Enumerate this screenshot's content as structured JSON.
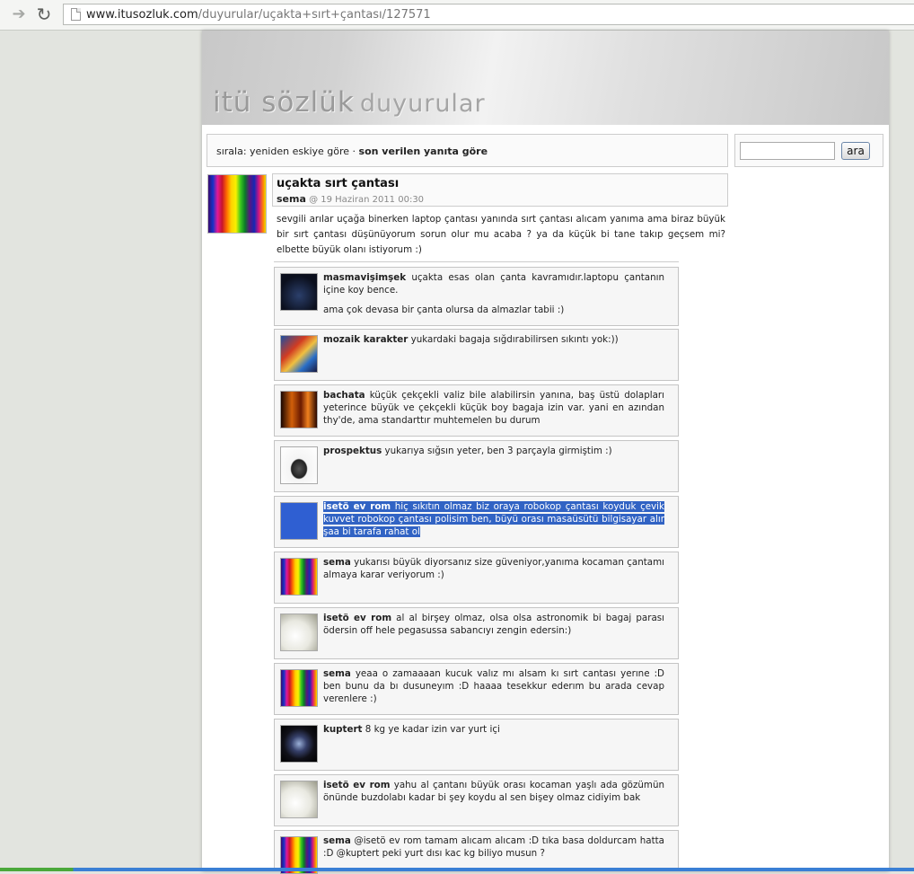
{
  "browser": {
    "back_icon": "arrow-right-icon",
    "reload_icon": "reload-icon",
    "url_domain": "www.itusozluk.com",
    "url_path": "/duyurular/uçakta+sırt+çantası/127571"
  },
  "site": {
    "logo_main": "itü sözlük",
    "logo_sub": "duyurular"
  },
  "sort": {
    "prefix": "sırala: yeniden eskiye göre · ",
    "active": "son verilen yanıta göre"
  },
  "search": {
    "value": "",
    "button_label": "ara"
  },
  "topic": {
    "title": "uçakta sırt çantası",
    "author": "sema",
    "date": " @ 19 Haziran 2011 00:30",
    "body": "sevgili arılar uçağa binerken laptop çantası yanında sırt çantası alıcam yanıma ama biraz büyük bir sırt çantası düşünüyorum sorun olur mu acaba ? ya da küçük bi tane takıp geçsem mi? elbette büyük olanı istiyorum :)"
  },
  "replies": [
    {
      "author": "masmavişimşek",
      "text": " uçakta esas olan çanta kavramıdır.laptopu çantanın içine koy bence.",
      "text2": "ama çok devasa bir çanta olursa da almazlar tabii :)"
    },
    {
      "author": "mozaik karakter",
      "text": " yukardaki bagaja sığdırabilirsen sıkıntı yok:))"
    },
    {
      "author": "bachata",
      "text": " küçük çekçekli valiz bile alabilirsin yanına, baş üstü dolapları yeterince büyük ve çekçekli küçük boy bagaja izin var. yani en azından thy'de, ama standarttır muhtemelen bu durum"
    },
    {
      "author": "prospektus",
      "text": " yukarıya sığsın yeter, ben 3 parçayla girmiştim :)"
    },
    {
      "author": "isetö ev rom",
      "text": " hiç sıkıtın olmaz biz oraya robokop çantası koyduk çevik kuvvet robokop çantası polisim ben, büyü orası masaüsütü bilgisayar alır şaa bi tarafa rahat ol"
    },
    {
      "author": "sema",
      "text": " yukarısı büyük diyorsanız size güveniyor,yanıma kocaman çantamı almaya karar veriyorum :)"
    },
    {
      "author": "isetö ev rom",
      "text": " al al birşey olmaz, olsa olsa astronomik bi bagaj parası ödersin off hele pegasussa sabancıyı zengin edersin:)"
    },
    {
      "author": "sema",
      "text": " yeaa o zamaaaan kucuk valız mı alsam kı sırt cantası yerıne :D ben bunu da bı dusuneyım :D haaaa tesekkur ederım bu arada cevap verenlere :)"
    },
    {
      "author": "kuptert",
      "text": " 8 kg ye kadar izin var yurt içi"
    },
    {
      "author": "isetö ev rom",
      "text": " yahu al çantanı büyük orası kocaman yaşlı ada gözümün önünde buzdolabı kadar bi şey koydu al sen bişey olmaz cidiyim bak"
    },
    {
      "author": "sema",
      "text": " @isetö ev rom tamam alıcam alıcam :D tıka basa doldurcam hatta :D @kuptert peki yurt dısı kac kg biliyo musun ?"
    }
  ]
}
